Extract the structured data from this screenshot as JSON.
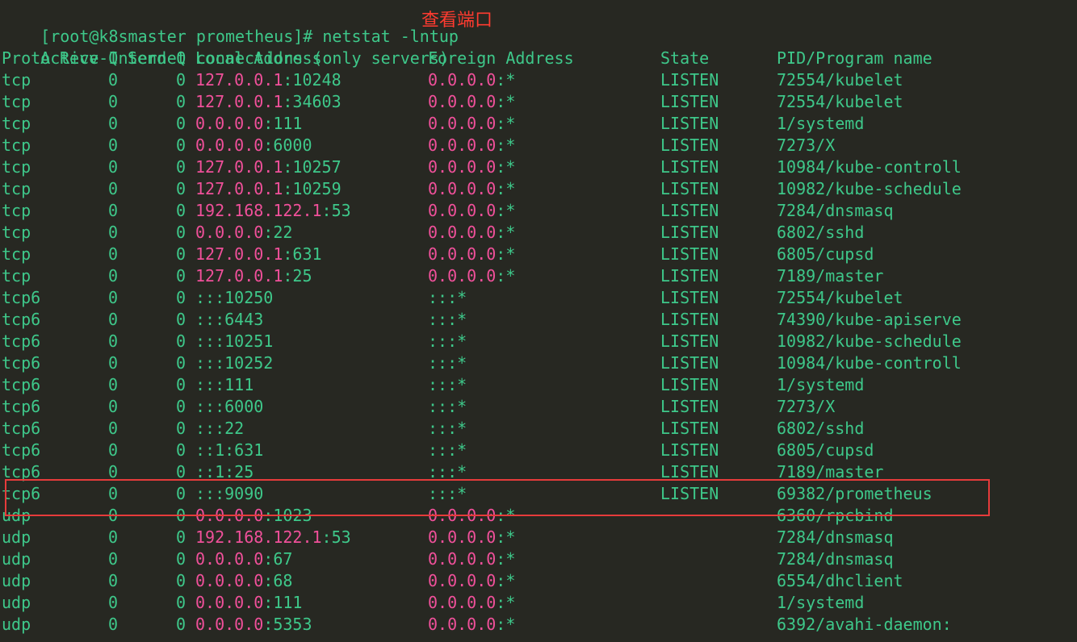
{
  "prompt": "[root@k8smaster prometheus]# netstat -lntup",
  "annotation": "查看端口",
  "summary_line": "Active Internet connections (only servers)",
  "headers": {
    "proto": "Proto",
    "recv": "Recv-Q",
    "send": "Send-Q",
    "local": "Local Address",
    "foreign": "Foreign Address",
    "state": "State",
    "pid": "PID/Program name"
  },
  "rows": [
    {
      "proto": "tcp",
      "recv": "0",
      "send": "0",
      "local_ip": "127.0.0.1",
      "local_port": ":10248",
      "foreign_ip": "0.0.0.0",
      "foreign_port": ":*",
      "state": "LISTEN",
      "pid": "72554/kubelet"
    },
    {
      "proto": "tcp",
      "recv": "0",
      "send": "0",
      "local_ip": "127.0.0.1",
      "local_port": ":34603",
      "foreign_ip": "0.0.0.0",
      "foreign_port": ":*",
      "state": "LISTEN",
      "pid": "72554/kubelet"
    },
    {
      "proto": "tcp",
      "recv": "0",
      "send": "0",
      "local_ip": "0.0.0.0",
      "local_port": ":111",
      "foreign_ip": "0.0.0.0",
      "foreign_port": ":*",
      "state": "LISTEN",
      "pid": "1/systemd"
    },
    {
      "proto": "tcp",
      "recv": "0",
      "send": "0",
      "local_ip": "0.0.0.0",
      "local_port": ":6000",
      "foreign_ip": "0.0.0.0",
      "foreign_port": ":*",
      "state": "LISTEN",
      "pid": "7273/X"
    },
    {
      "proto": "tcp",
      "recv": "0",
      "send": "0",
      "local_ip": "127.0.0.1",
      "local_port": ":10257",
      "foreign_ip": "0.0.0.0",
      "foreign_port": ":*",
      "state": "LISTEN",
      "pid": "10984/kube-controll"
    },
    {
      "proto": "tcp",
      "recv": "0",
      "send": "0",
      "local_ip": "127.0.0.1",
      "local_port": ":10259",
      "foreign_ip": "0.0.0.0",
      "foreign_port": ":*",
      "state": "LISTEN",
      "pid": "10982/kube-schedule"
    },
    {
      "proto": "tcp",
      "recv": "0",
      "send": "0",
      "local_ip": "192.168.122.1",
      "local_port": ":53",
      "foreign_ip": "0.0.0.0",
      "foreign_port": ":*",
      "state": "LISTEN",
      "pid": "7284/dnsmasq"
    },
    {
      "proto": "tcp",
      "recv": "0",
      "send": "0",
      "local_ip": "0.0.0.0",
      "local_port": ":22",
      "foreign_ip": "0.0.0.0",
      "foreign_port": ":*",
      "state": "LISTEN",
      "pid": "6802/sshd"
    },
    {
      "proto": "tcp",
      "recv": "0",
      "send": "0",
      "local_ip": "127.0.0.1",
      "local_port": ":631",
      "foreign_ip": "0.0.0.0",
      "foreign_port": ":*",
      "state": "LISTEN",
      "pid": "6805/cupsd"
    },
    {
      "proto": "tcp",
      "recv": "0",
      "send": "0",
      "local_ip": "127.0.0.1",
      "local_port": ":25",
      "foreign_ip": "0.0.0.0",
      "foreign_port": ":*",
      "state": "LISTEN",
      "pid": "7189/master"
    },
    {
      "proto": "tcp6",
      "recv": "0",
      "send": "0",
      "local_ip": "",
      "local_port": ":::10250",
      "foreign_ip": "",
      "foreign_port": ":::*",
      "state": "LISTEN",
      "pid": "72554/kubelet"
    },
    {
      "proto": "tcp6",
      "recv": "0",
      "send": "0",
      "local_ip": "",
      "local_port": ":::6443",
      "foreign_ip": "",
      "foreign_port": ":::*",
      "state": "LISTEN",
      "pid": "74390/kube-apiserve"
    },
    {
      "proto": "tcp6",
      "recv": "0",
      "send": "0",
      "local_ip": "",
      "local_port": ":::10251",
      "foreign_ip": "",
      "foreign_port": ":::*",
      "state": "LISTEN",
      "pid": "10982/kube-schedule"
    },
    {
      "proto": "tcp6",
      "recv": "0",
      "send": "0",
      "local_ip": "",
      "local_port": ":::10252",
      "foreign_ip": "",
      "foreign_port": ":::*",
      "state": "LISTEN",
      "pid": "10984/kube-controll"
    },
    {
      "proto": "tcp6",
      "recv": "0",
      "send": "0",
      "local_ip": "",
      "local_port": ":::111",
      "foreign_ip": "",
      "foreign_port": ":::*",
      "state": "LISTEN",
      "pid": "1/systemd"
    },
    {
      "proto": "tcp6",
      "recv": "0",
      "send": "0",
      "local_ip": "",
      "local_port": ":::6000",
      "foreign_ip": "",
      "foreign_port": ":::*",
      "state": "LISTEN",
      "pid": "7273/X"
    },
    {
      "proto": "tcp6",
      "recv": "0",
      "send": "0",
      "local_ip": "",
      "local_port": ":::22",
      "foreign_ip": "",
      "foreign_port": ":::*",
      "state": "LISTEN",
      "pid": "6802/sshd"
    },
    {
      "proto": "tcp6",
      "recv": "0",
      "send": "0",
      "local_ip": "",
      "local_port": "::1:631",
      "foreign_ip": "",
      "foreign_port": ":::*",
      "state": "LISTEN",
      "pid": "6805/cupsd"
    },
    {
      "proto": "tcp6",
      "recv": "0",
      "send": "0",
      "local_ip": "",
      "local_port": "::1:25",
      "foreign_ip": "",
      "foreign_port": ":::*",
      "state": "LISTEN",
      "pid": "7189/master"
    },
    {
      "proto": "tcp6",
      "recv": "0",
      "send": "0",
      "local_ip": "",
      "local_port": ":::9090",
      "foreign_ip": "",
      "foreign_port": ":::*",
      "state": "LISTEN",
      "pid": "69382/prometheus"
    },
    {
      "proto": "udp",
      "recv": "0",
      "send": "0",
      "local_ip": "0.0.0.0",
      "local_port": ":1023",
      "foreign_ip": "0.0.0.0",
      "foreign_port": ":*",
      "state": "",
      "pid": "6360/rpcbind"
    },
    {
      "proto": "udp",
      "recv": "0",
      "send": "0",
      "local_ip": "192.168.122.1",
      "local_port": ":53",
      "foreign_ip": "0.0.0.0",
      "foreign_port": ":*",
      "state": "",
      "pid": "7284/dnsmasq"
    },
    {
      "proto": "udp",
      "recv": "0",
      "send": "0",
      "local_ip": "0.0.0.0",
      "local_port": ":67",
      "foreign_ip": "0.0.0.0",
      "foreign_port": ":*",
      "state": "",
      "pid": "7284/dnsmasq"
    },
    {
      "proto": "udp",
      "recv": "0",
      "send": "0",
      "local_ip": "0.0.0.0",
      "local_port": ":68",
      "foreign_ip": "0.0.0.0",
      "foreign_port": ":*",
      "state": "",
      "pid": "6554/dhclient"
    },
    {
      "proto": "udp",
      "recv": "0",
      "send": "0",
      "local_ip": "0.0.0.0",
      "local_port": ":111",
      "foreign_ip": "0.0.0.0",
      "foreign_port": ":*",
      "state": "",
      "pid": "1/systemd"
    },
    {
      "proto": "udp",
      "recv": "0",
      "send": "0",
      "local_ip": "0.0.0.0",
      "local_port": ":5353",
      "foreign_ip": "0.0.0.0",
      "foreign_port": ":*",
      "state": "",
      "pid": "6392/avahi-daemon:"
    }
  ],
  "colors": {
    "background": "#272822",
    "text": "#3ec88a",
    "ip": "#f0509a",
    "annotation": "#ff3b30",
    "highlight_border": "#e63b3b"
  }
}
